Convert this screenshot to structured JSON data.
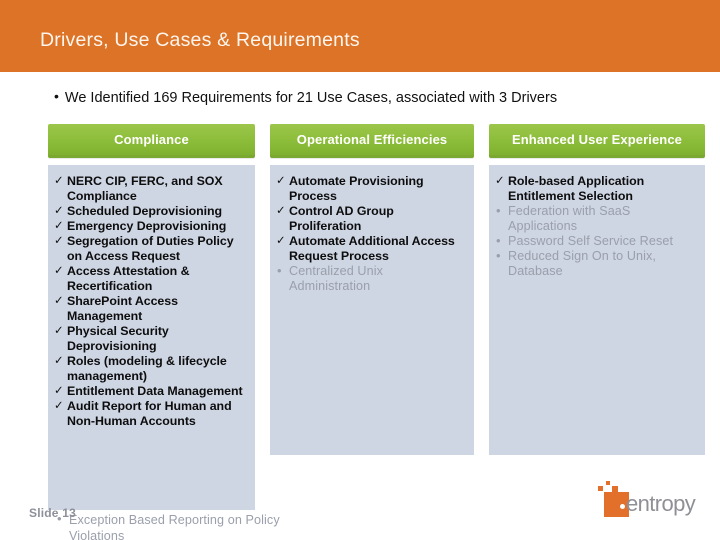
{
  "slide": {
    "title": "Drivers, Use Cases & Requirements",
    "subtitle": "We Identified 169 Requirements for 21 Use Cases, associated with 3 Drivers",
    "subtitle_bullet": "•",
    "slide_number": "Slide 13",
    "colors": {
      "title_bar": "#DD7326",
      "header_green": "#8CBE3F",
      "panel_background": "#CED5E3",
      "bold_text": "#0D0D0D",
      "muted_text": "#9A9FAB",
      "logo_orange": "#E2702A"
    }
  },
  "columns": [
    {
      "header": "Compliance",
      "items": [
        {
          "marker": "✓",
          "type": "check",
          "text": "NERC CIP, FERC, and SOX Compliance"
        },
        {
          "marker": "✓",
          "type": "check",
          "text": "Scheduled Deprovisioning"
        },
        {
          "marker": "✓",
          "type": "check",
          "text": "Emergency Deprovisioning"
        },
        {
          "marker": "✓",
          "type": "check",
          "text": "Segregation of Duties Policy on Access Request"
        },
        {
          "marker": "✓",
          "type": "check",
          "text": "Access Attestation & Recertification"
        },
        {
          "marker": "✓",
          "type": "check",
          "text": "SharePoint Access Management"
        },
        {
          "marker": "✓",
          "type": "check",
          "text": "Physical Security Deprovisioning"
        },
        {
          "marker": "✓",
          "type": "check",
          "text": "Roles (modeling & lifecycle management)"
        },
        {
          "marker": "✓",
          "type": "check",
          "text": "Entitlement Data Management"
        },
        {
          "marker": "✓",
          "type": "check",
          "text": "Audit Report for Human and Non-Human Accounts"
        }
      ],
      "overflow_item": {
        "marker": "•",
        "type": "dot",
        "text": "Exception Based Reporting on Policy Violations"
      }
    },
    {
      "header": "Operational Efficiencies",
      "items": [
        {
          "marker": "✓",
          "type": "check",
          "text": "Automate Provisioning Process"
        },
        {
          "marker": "✓",
          "type": "check",
          "text": "Control AD Group Proliferation"
        },
        {
          "marker": "✓",
          "type": "check",
          "text": "Automate Additional Access Request Process"
        },
        {
          "marker": "•",
          "type": "dot",
          "text": "Centralized Unix Administration"
        }
      ]
    },
    {
      "header": "Enhanced User Experience",
      "items": [
        {
          "marker": "✓",
          "type": "check",
          "text": "Role-based Application Entitlement Selection"
        },
        {
          "marker": "•",
          "type": "dot",
          "text": "Federation with SaaS Applications"
        },
        {
          "marker": "•",
          "type": "dot",
          "text": "Password Self Service Reset"
        },
        {
          "marker": "•",
          "type": "dot",
          "text": "Reduced Sign On to Unix, Database"
        }
      ]
    }
  ],
  "logo": {
    "wordmark": "entropy",
    "name": "identropy-logo"
  }
}
